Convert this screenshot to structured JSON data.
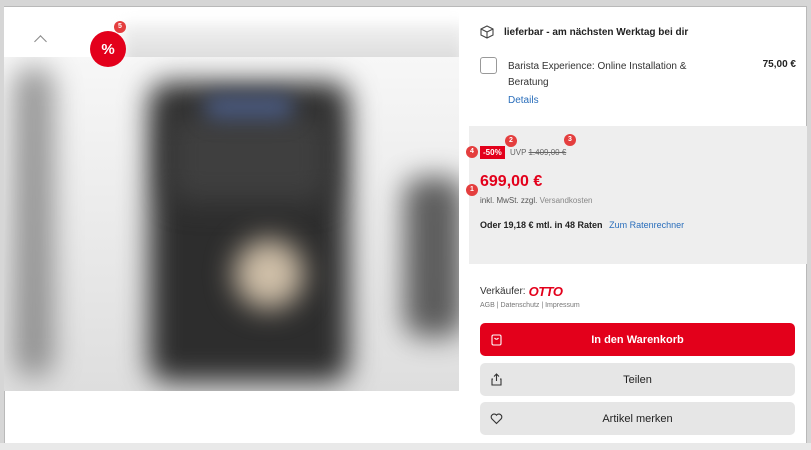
{
  "gallery": {
    "sale_badge": "%",
    "sale_badge_marker": "5"
  },
  "shipping": {
    "text": "lieferbar - am nächsten Werktag bei dir"
  },
  "service": {
    "label": "Barista Experience: Online Installation & Beratung",
    "price": "75,00 €",
    "details_link": "Details"
  },
  "price": {
    "discount": "-50%",
    "uvp_label": "UVP",
    "uvp_value": "1.409,00 €",
    "current": "699,00 €",
    "vat_text": "inkl. MwSt. zzgl.",
    "shipping_costs": "Versandkosten",
    "installment": "Oder 19,18 € mtl. in 48 Raten",
    "installment_link": "Zum Ratenrechner"
  },
  "markers": {
    "m1": "1",
    "m2": "2",
    "m3": "3",
    "m4": "4"
  },
  "seller": {
    "label": "Verkäufer:",
    "name": "OTTO",
    "legal": "AGB | Datenschutz | Impressum"
  },
  "buttons": {
    "cart": "In den Warenkorb",
    "share": "Teilen",
    "wishlist": "Artikel merken"
  },
  "colors": {
    "brand_red": "#e3001b",
    "link_blue": "#2a6ebb",
    "marker_red": "#e43e3e"
  }
}
